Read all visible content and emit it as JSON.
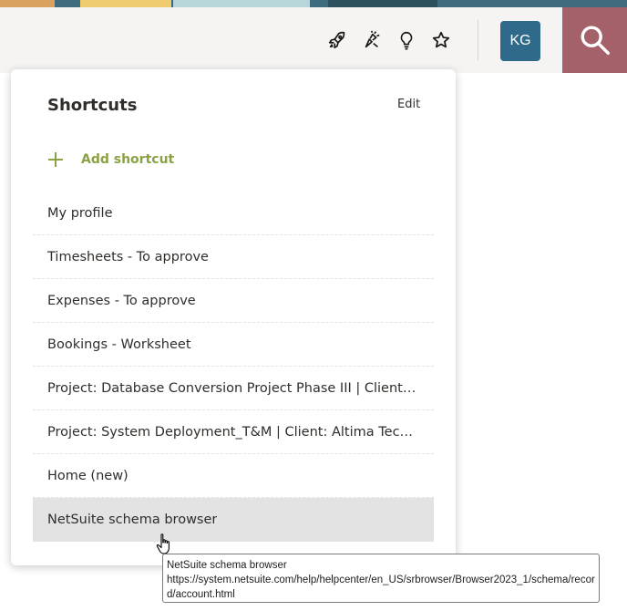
{
  "header": {
    "icons": {
      "rocket": "rocket-icon",
      "setup": "setup-assistant-icon",
      "bulb": "lightbulb-icon",
      "star": "star-icon",
      "search": "search-icon"
    },
    "avatar_initials": "KG",
    "colors": {
      "bar_bg": "#f5f4f2",
      "avatar_bg": "#2f6a8a",
      "search_bg": "#a5616a",
      "accent_green": "#8aa244"
    }
  },
  "shortcuts": {
    "title": "Shortcuts",
    "edit_label": "Edit",
    "add_label": "Add shortcut",
    "items": [
      {
        "label": "My profile"
      },
      {
        "label": "Timesheets - To approve"
      },
      {
        "label": "Expenses - To approve"
      },
      {
        "label": "Bookings - Worksheet"
      },
      {
        "label": "Project: Database Conversion Project Phase III | Client: Fernhill Corporation"
      },
      {
        "label": "Project: System Deployment_T&M | Client: Altima Technology"
      },
      {
        "label": "Home (new)"
      },
      {
        "label": "NetSuite schema browser"
      }
    ]
  },
  "tooltip": {
    "title": "NetSuite schema browser",
    "url": "https://system.netsuite.com/help/helpcenter/en_US/srbrowser/Browser2023_1/schema/record/account.html"
  }
}
